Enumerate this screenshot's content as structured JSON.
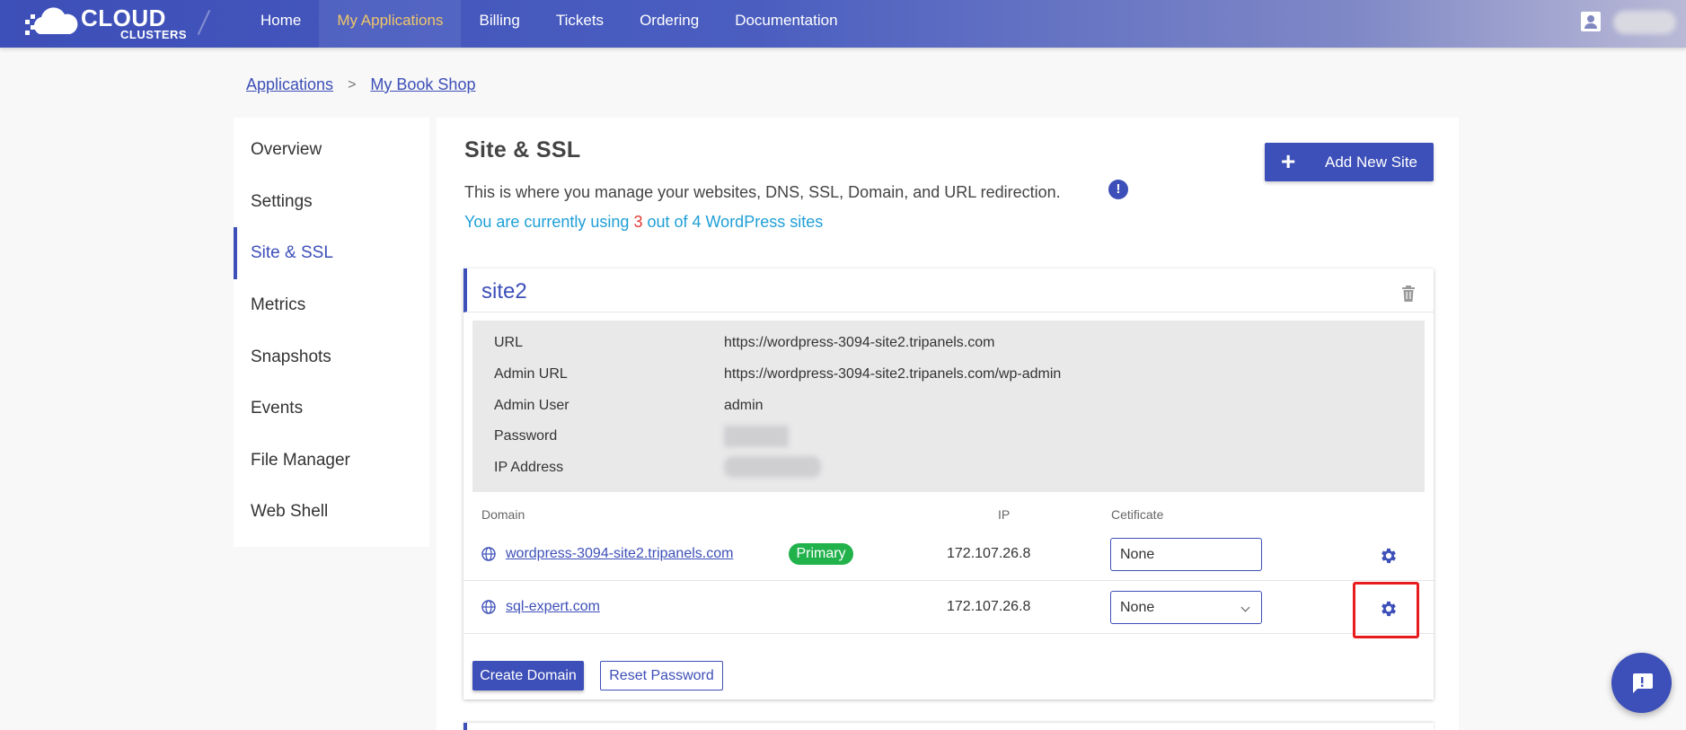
{
  "brand": {
    "line1": "CLOUD",
    "line2": "CLUSTERS"
  },
  "nav": {
    "items": [
      {
        "label": "Home"
      },
      {
        "label": "My Applications",
        "active": true
      },
      {
        "label": "Billing"
      },
      {
        "label": "Tickets"
      },
      {
        "label": "Ordering"
      },
      {
        "label": "Documentation"
      }
    ]
  },
  "breadcrumb": {
    "root": "Applications",
    "separator": ">",
    "current": "My Book Shop"
  },
  "sidebar": {
    "items": [
      {
        "label": "Overview"
      },
      {
        "label": "Settings"
      },
      {
        "label": "Site & SSL",
        "active": true
      },
      {
        "label": "Metrics"
      },
      {
        "label": "Snapshots"
      },
      {
        "label": "Events"
      },
      {
        "label": "File Manager"
      },
      {
        "label": "Web Shell"
      }
    ]
  },
  "main": {
    "title": "Site & SSL",
    "description": "This is where you manage your websites, DNS, SSL, Domain, and URL redirection.",
    "info_icon": "!",
    "usage": {
      "prefix": "You are currently using ",
      "used": "3",
      "suffix": " out of 4 WordPress sites"
    },
    "add_button": {
      "icon": "+",
      "label": "Add New Site"
    }
  },
  "site": {
    "name": "site2",
    "details": [
      {
        "label": "URL",
        "value": "https://wordpress-3094-site2.tripanels.com"
      },
      {
        "label": "Admin URL",
        "value": "https://wordpress-3094-site2.tripanels.com/wp-admin"
      },
      {
        "label": "Admin User",
        "value": "admin"
      },
      {
        "label": "Password",
        "value": ""
      },
      {
        "label": "IP Address",
        "value": ""
      }
    ],
    "columns": {
      "domain": "Domain",
      "ip": "IP",
      "certificate": "Cetificate"
    },
    "domains": [
      {
        "domain": "wordpress-3094-site2.tripanels.com",
        "badge": "Primary",
        "ip": "172.107.26.8",
        "certificate": "None"
      },
      {
        "domain": "sql-expert.com",
        "badge": "",
        "ip": "172.107.26.8",
        "certificate": "None"
      }
    ],
    "buttons": {
      "create": "Create Domain",
      "reset": "Reset Password"
    }
  },
  "colors": {
    "accent": "#3d4fb8",
    "active_nav": "#f0c66a",
    "usage_text": "#1e9fd6",
    "usage_count": "#e53935",
    "primary_badge": "#22b24c",
    "highlight": "#e81c1c"
  }
}
